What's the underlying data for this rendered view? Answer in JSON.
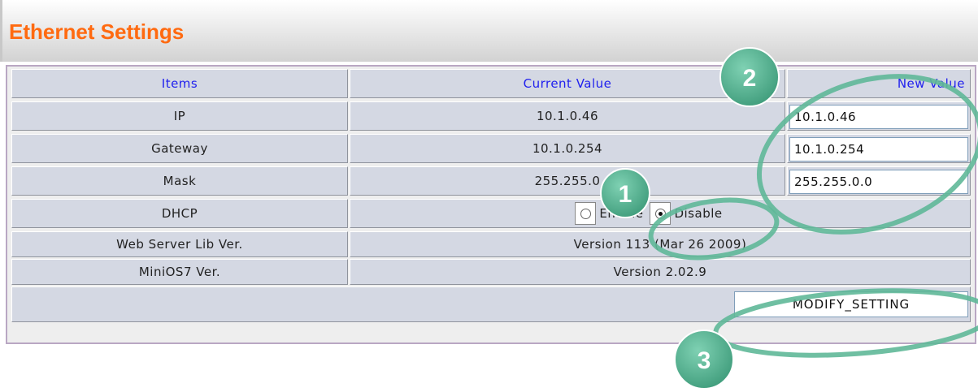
{
  "page": {
    "title": "Ethernet Settings"
  },
  "table": {
    "headers": {
      "items": "Items",
      "current": "Current Value",
      "new": "New Value"
    },
    "rows": {
      "ip": {
        "label": "IP",
        "current": "10.1.0.46",
        "new": "10.1.0.46"
      },
      "gateway": {
        "label": "Gateway",
        "current": "10.1.0.254",
        "new": "10.1.0.254"
      },
      "mask": {
        "label": "Mask",
        "current": "255.255.0",
        "new": "255.255.0.0"
      },
      "dhcp": {
        "label": "DHCP",
        "enable_label": "Enable",
        "disable_label": "Disable",
        "selected": "Disable"
      },
      "web_server": {
        "label": "Web Server Lib Ver.",
        "value": "Version 113 (Mar 26 2009)"
      },
      "minios": {
        "label": "MiniOS7 Ver.",
        "value": "Version 2.02.9"
      }
    },
    "submit_label": "MODIFY_SETTING"
  },
  "annotations": {
    "badge_1": "1",
    "badge_2": "2",
    "badge_3": "3",
    "color": "#5fb898"
  }
}
